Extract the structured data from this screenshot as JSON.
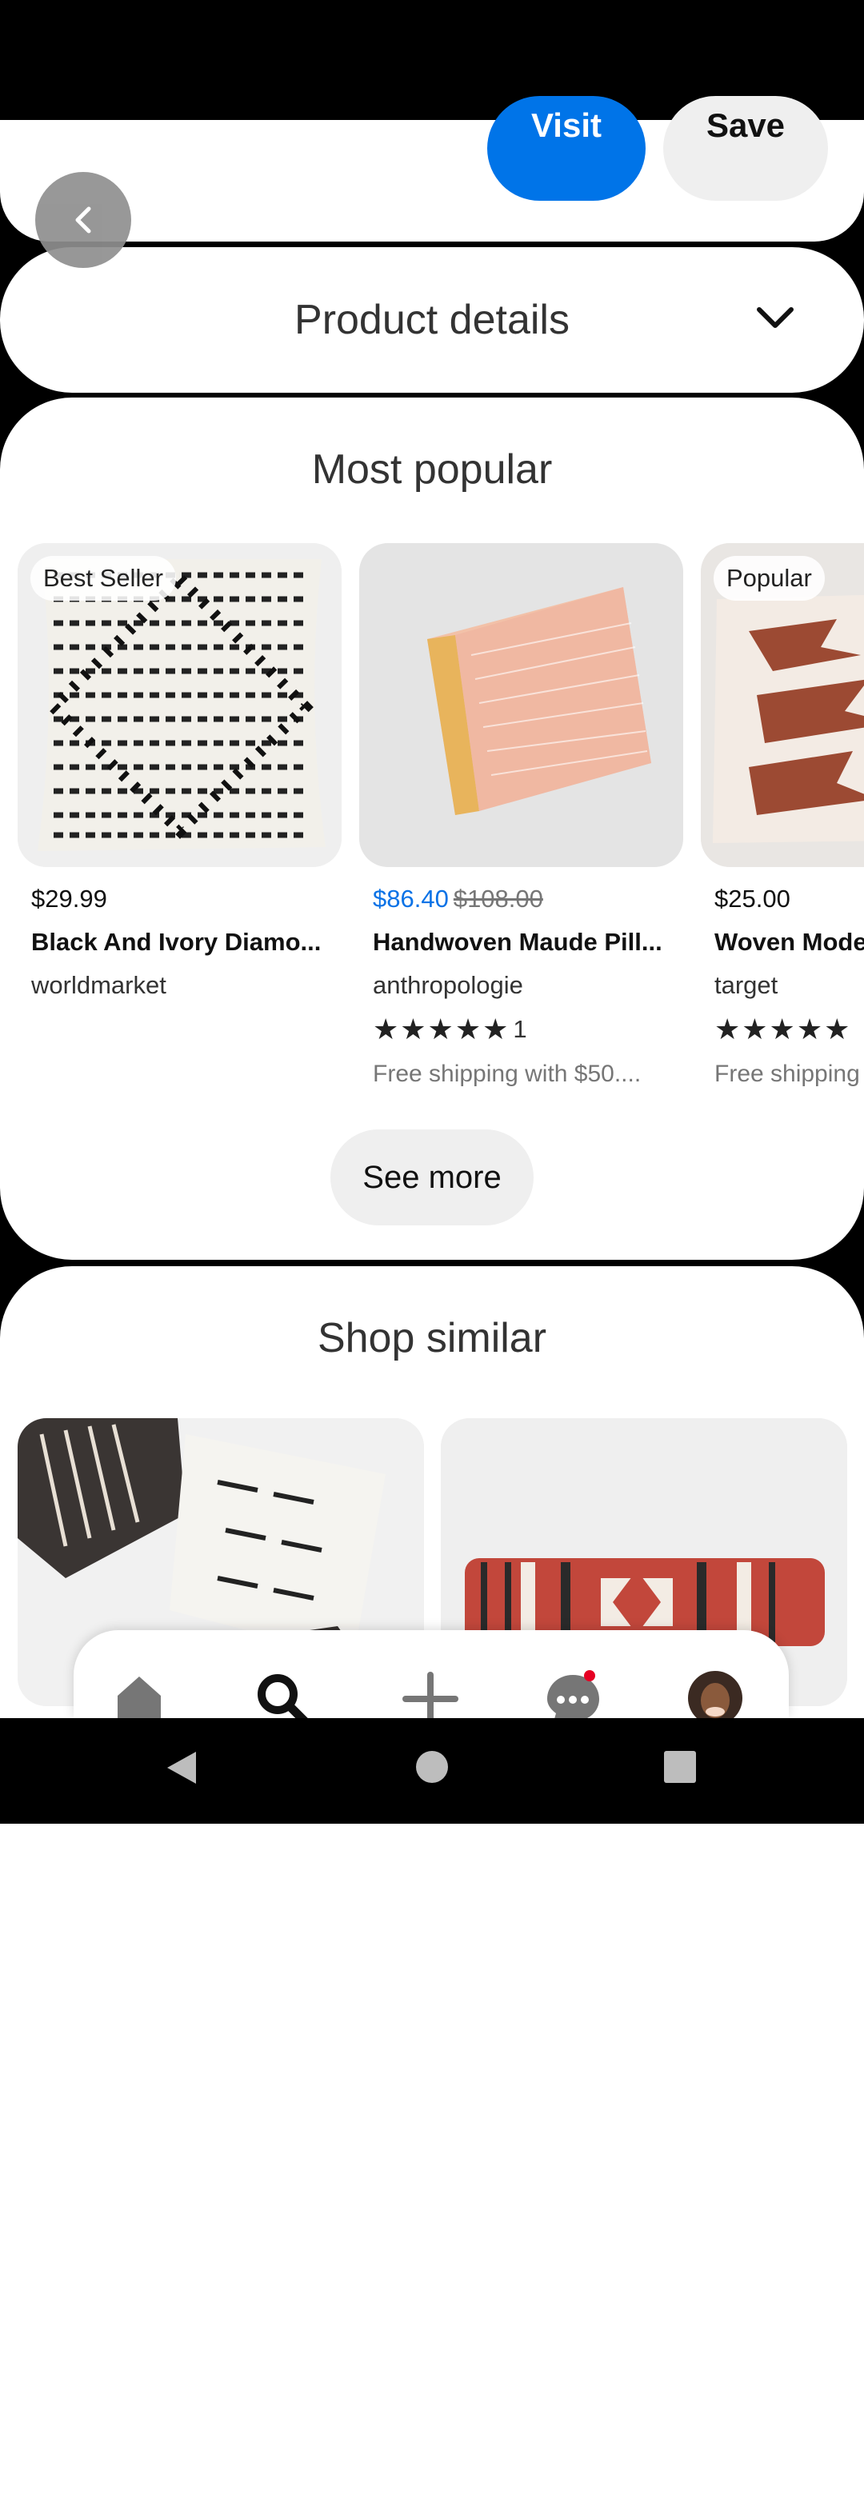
{
  "top_actions": {
    "visit_label": "Visit",
    "save_label": "Save"
  },
  "product_details": {
    "title": "Product details"
  },
  "most_popular": {
    "title": "Most popular",
    "items": [
      {
        "badge": "Best Seller",
        "price": "$29.99",
        "name": "Black And Ivory Diamo...",
        "merchant": "worldmarket"
      },
      {
        "sale_price": "$86.40",
        "original_price": "$108.00",
        "name": "Handwoven Maude Pill...",
        "merchant": "anthropologie",
        "stars": "★★★★★",
        "rating_count": "1",
        "shipping": "Free shipping with $50...."
      },
      {
        "badge": "Popular",
        "price": "$25.00",
        "name": "Woven Mode",
        "merchant": "target",
        "stars": "★★★★★",
        "shipping": "Free shipping"
      }
    ],
    "see_more_label": "See more"
  },
  "shop_similar": {
    "title": "Shop similar"
  },
  "bottom_nav": {
    "items": [
      "home-icon",
      "search-icon",
      "create-icon",
      "messages-icon",
      "profile-avatar"
    ]
  },
  "system_nav": {
    "items": [
      "back",
      "home",
      "recents"
    ]
  },
  "colors": {
    "accent": "#0074e8",
    "sale": "#0a72e6",
    "notification": "#e60023"
  }
}
